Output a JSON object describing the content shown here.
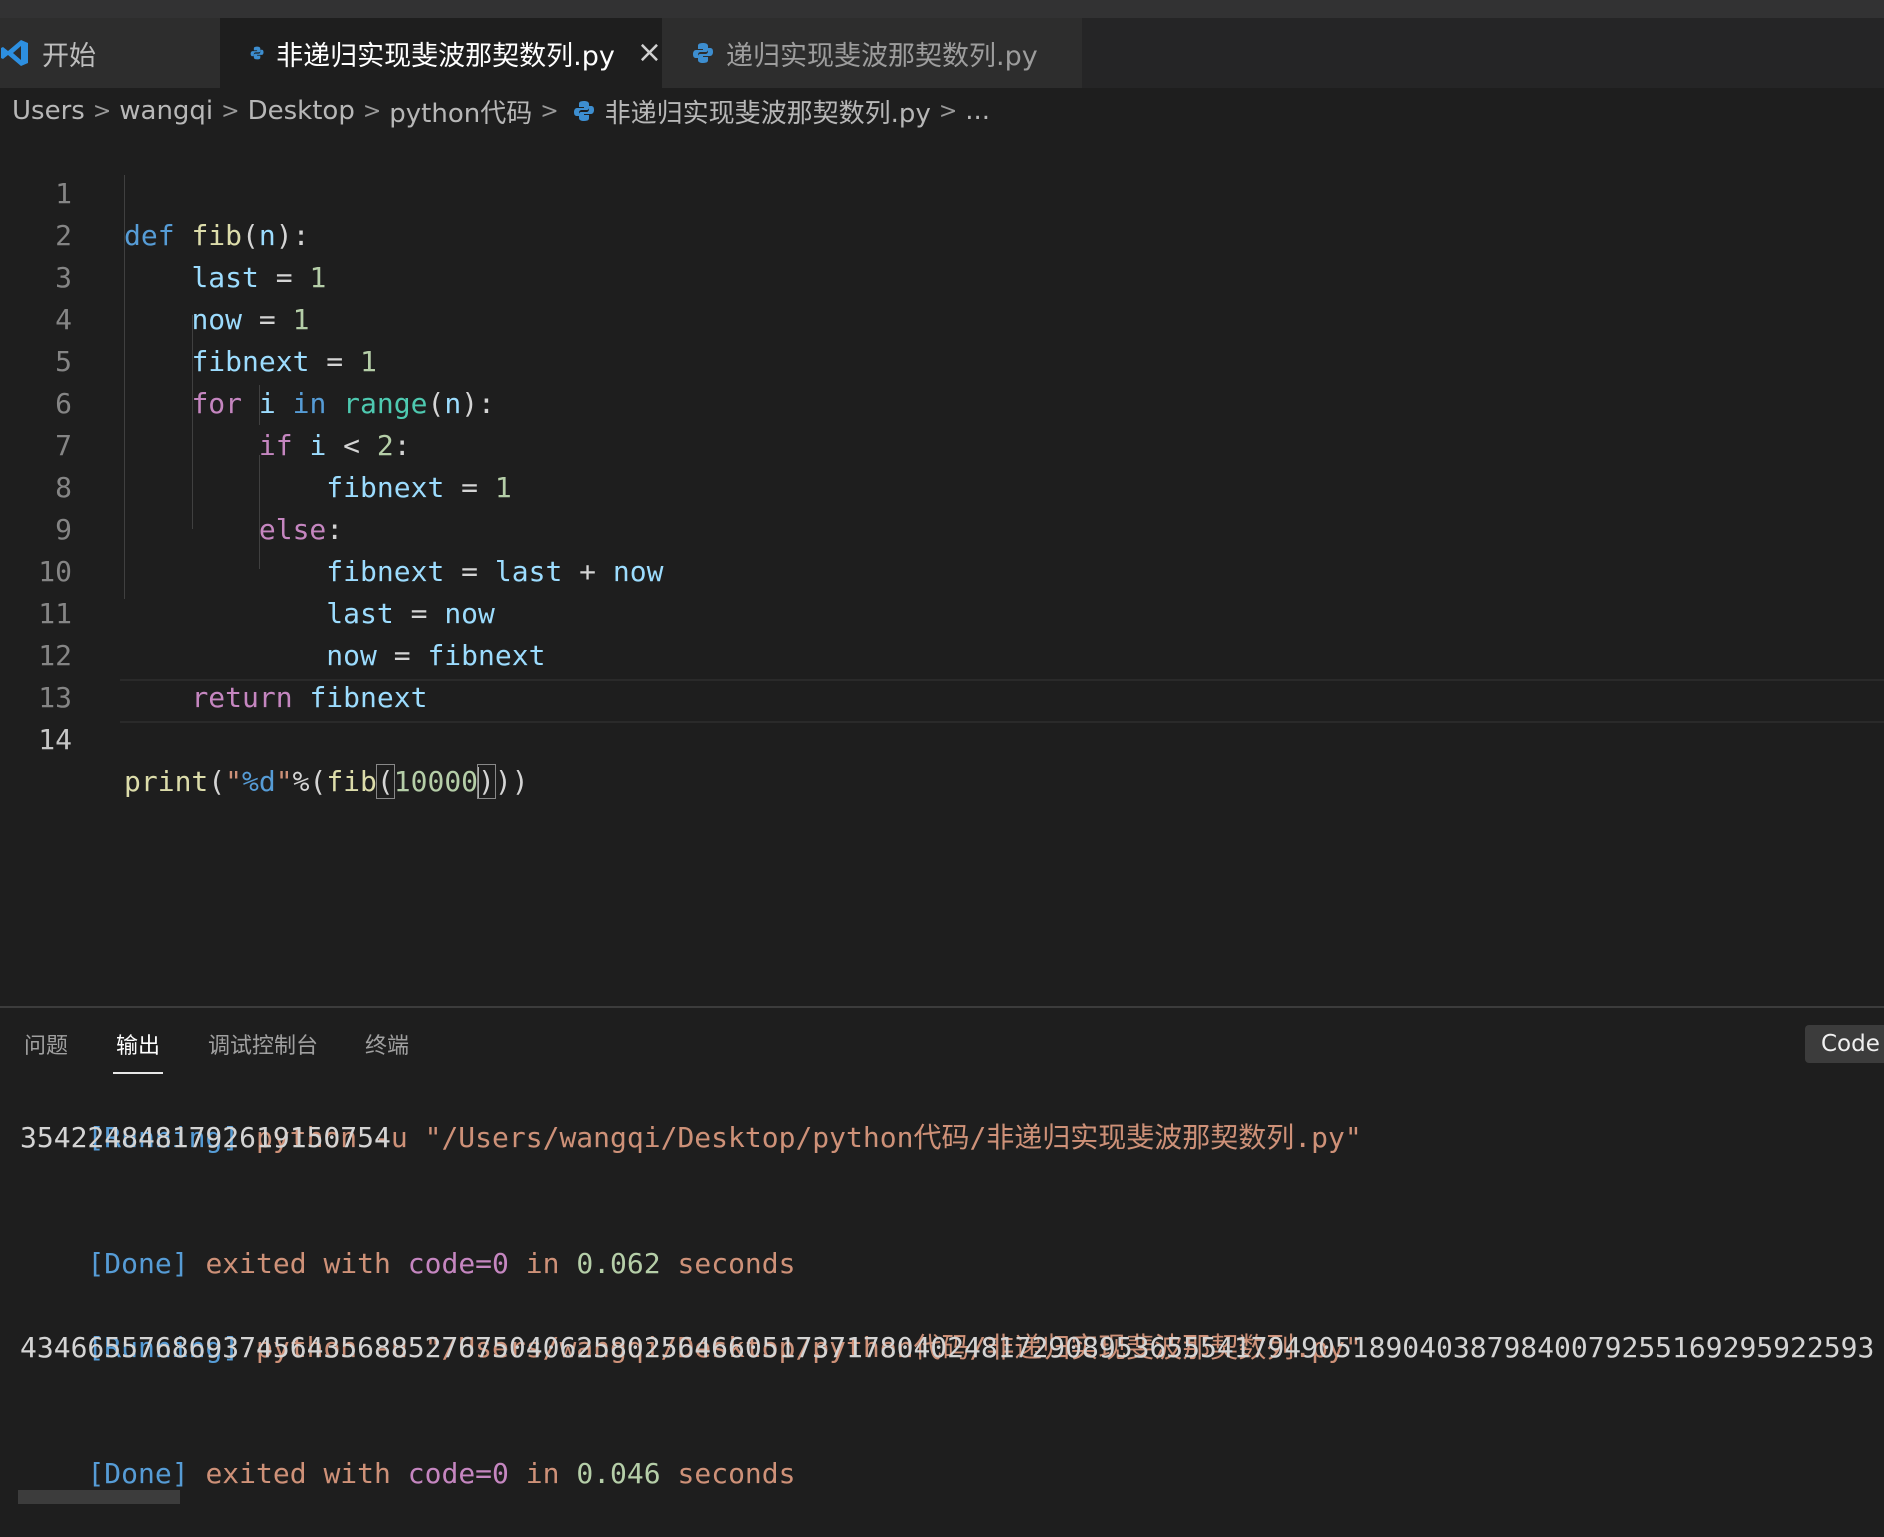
{
  "window": {
    "title": ""
  },
  "tabs": [
    {
      "label": "开始",
      "icon": "vscode-logo-icon"
    },
    {
      "label": "非递归实现斐波那契数列.py",
      "icon": "python-icon",
      "active": true,
      "close": "×"
    },
    {
      "label": "递归实现斐波那契数列.py",
      "icon": "python-icon"
    }
  ],
  "breadcrumb": {
    "items": [
      "Users",
      "wangqi",
      "Desktop",
      "python代码",
      "非递归实现斐波那契数列.py",
      "..."
    ],
    "separator": ">"
  },
  "editor": {
    "line_numbers": [
      "1",
      "2",
      "3",
      "4",
      "5",
      "6",
      "7",
      "8",
      "9",
      "10",
      "11",
      "12",
      "13",
      "14"
    ],
    "current_line": 14,
    "tokens": {
      "def": "def",
      "fib": "fib",
      "n": "n",
      "colon_paren": "):",
      "open": "(",
      "last": "last",
      "now": "now",
      "fibnext": "fibnext",
      "eq": " = ",
      "one": "1",
      "for": "for",
      "i": "i",
      "in": "in",
      "range": "range",
      "if": "if",
      "lt": " < ",
      "two": "2",
      "colon": ":",
      "else": "else",
      "plus": " + ",
      "return": "return",
      "print": "print",
      "q1": "\"",
      "fmt": "%d",
      "q2": "\"",
      "pct": "%(",
      "arg": "10000",
      "close1": ")",
      "close2": "))"
    }
  },
  "panel": {
    "tabs": [
      "问题",
      "输出",
      "调试控制台",
      "终端"
    ],
    "active_tab": "输出",
    "dropdown": "Code"
  },
  "output": {
    "run1": {
      "tag": "[Running]",
      "cmd": " python -u \"/Users/wangqi/Desktop/python代码/非递归实现斐波那契数列.py\""
    },
    "result1": "3542248481792619150754",
    "done1": {
      "tag": "[Done]",
      "text1": " exited with ",
      "code": "code=0",
      "text2": " in ",
      "time": "0.062",
      "text3": " seconds"
    },
    "run2": {
      "tag": "[Running]",
      "cmd": " python -u \"/Users/wangqi/Desktop/python代码/非递归实现斐波那契数列.py\""
    },
    "result2": "43466557686937456435688527675040625802564660517371780402481729089536555417949051890403879840079255169295922593",
    "done2": {
      "tag": "[Done]",
      "text1": " exited with ",
      "code": "code=0",
      "text2": " in ",
      "time": "0.046",
      "text3": " seconds"
    }
  }
}
